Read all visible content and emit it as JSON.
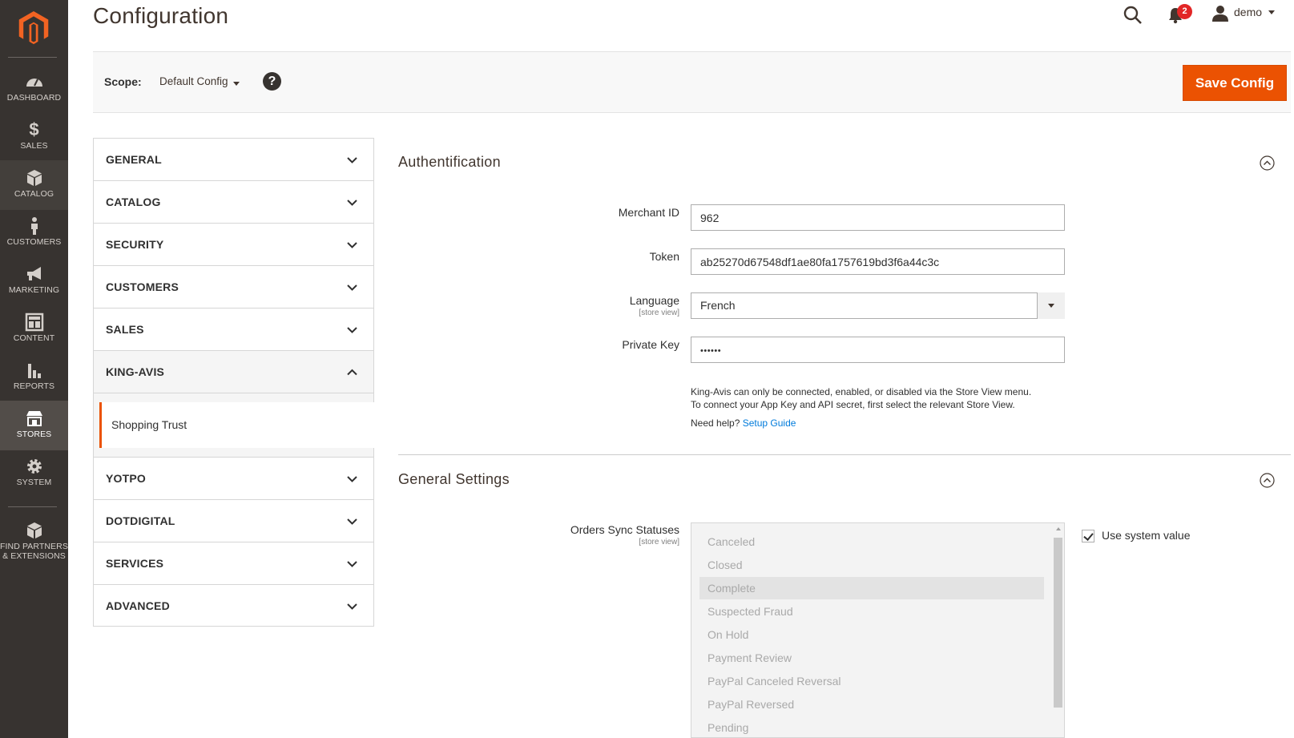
{
  "nav": {
    "items": [
      {
        "label": "Dashboard",
        "icon": "dashboard-icon"
      },
      {
        "label": "$",
        "icon": "dollar-icon"
      },
      {
        "label": "Sales"
      },
      {
        "label": "Catalog",
        "icon": "box-icon"
      },
      {
        "label": "Customers",
        "icon": "person-icon"
      },
      {
        "label": "Marketing",
        "icon": "megaphone-icon"
      },
      {
        "label": "Content",
        "icon": "layout-icon"
      },
      {
        "label": "Reports",
        "icon": "bar-chart-icon"
      },
      {
        "label": "Stores",
        "icon": "store-icon"
      },
      {
        "label": "System",
        "icon": "gear-icon"
      },
      {
        "label": "Find Partners\n& Extensions",
        "icon": "extensions-icon"
      }
    ],
    "active": "Stores"
  },
  "header": {
    "title": "Configuration",
    "notifications_count": "2",
    "user_name": "demo"
  },
  "scope": {
    "label": "Scope:",
    "value": "Default Config",
    "help": "?",
    "save_label": "Save Config"
  },
  "tabs": {
    "general": "GENERAL",
    "catalog": "CATALOG",
    "security": "SECURITY",
    "customers": "CUSTOMERS",
    "sales": "SALES",
    "king_avis": "KING-AVIS",
    "shopping_trust": "Shopping Trust",
    "yotpo": "YOTPO",
    "dotdigital": "DOTDIGITAL",
    "services": "SERVICES",
    "advanced": "ADVANCED"
  },
  "auth": {
    "title": "Authentification",
    "merchant_id_label": "Merchant ID",
    "merchant_id_value": "962",
    "token_label": "Token",
    "token_value": "ab25270d67548df1ae80fa1757619bd3f6a44c3c",
    "language_label": "Language",
    "language_scope": "[store view]",
    "language_value": "French",
    "private_key_label": "Private Key",
    "private_key_value": "••••••",
    "note_line1": "King-Avis can only be connected, enabled, or disabled via the Store View menu.",
    "note_line2": "To connect your App Key and API secret, first select the relevant Store View.",
    "help_prefix": "Need help?",
    "help_link": "Setup Guide"
  },
  "general_settings": {
    "title": "General Settings",
    "orders_label": "Orders Sync Statuses",
    "orders_scope": "[store view]",
    "options": [
      "Canceled",
      "Closed",
      "Complete",
      "Suspected Fraud",
      "On Hold",
      "Payment Review",
      "PayPal Canceled Reversal",
      "PayPal Reversed",
      "Pending"
    ],
    "selected_option": "Complete",
    "use_system_value": "Use system value",
    "use_system_value_checked": true
  },
  "colors": {
    "accent": "#eb5202",
    "sidebar": "#373330",
    "link": "#007bdb"
  }
}
